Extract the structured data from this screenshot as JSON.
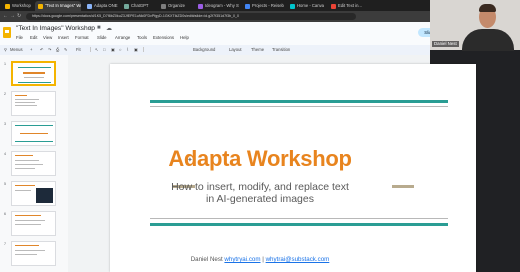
{
  "browser": {
    "tabs": [
      {
        "label": "Workshop",
        "active": false,
        "color": "#f4b400"
      },
      {
        "label": "\"Text In Images\" Works",
        "active": true,
        "color": "#f4b400"
      },
      {
        "label": "Adapta ONE",
        "active": false,
        "color": "#8ab4f8"
      },
      {
        "label": "ChatGPT",
        "active": false,
        "color": "#74aa9c"
      },
      {
        "label": "Organize",
        "active": false,
        "color": "#7e7e7e"
      },
      {
        "label": "Ideogram - Why Style",
        "active": false,
        "color": "#9b5de5"
      },
      {
        "label": "Projects - Reiseb",
        "active": false,
        "color": "#4285f4"
      },
      {
        "label": "Home - Canva",
        "active": false,
        "color": "#00c4cc"
      },
      {
        "label": "Edit Text in...",
        "active": false,
        "color": "#ea4335"
      }
    ],
    "url": "https://docs.google.com/presentation/d/1K5_D7f8bZ0kuZ3JfEPE1uNk0FDvPfgyD-1GKXTIkZD0s/edit#slide=id.g2f7f351d7f3b_0_0"
  },
  "docs": {
    "title": "\"Text In Images\" Workshop",
    "menu": [
      "File",
      "Edit",
      "View",
      "Insert",
      "Format",
      "Slide",
      "Arrange",
      "Tools",
      "Extensions",
      "Help"
    ],
    "slideshow_label": "Slides",
    "toolbar": {
      "menus_label": "Menus",
      "zoom_label": "Fit",
      "background_label": "Background",
      "layout_label": "Layout",
      "theme_label": "Theme",
      "transition_label": "Transition"
    }
  },
  "filmstrip": {
    "numbers": [
      "1",
      "2",
      "3",
      "4",
      "5",
      "6",
      "7"
    ]
  },
  "slide": {
    "title": "Adapta Workshop",
    "subtitle_line1": "How to insert, modify, and replace text",
    "subtitle_line2": "in AI-generated images",
    "footer_name": "Daniel Nest",
    "footer_link1": "whytryai.com",
    "footer_sep": "|",
    "footer_link2": "whytrai@substack.com"
  },
  "webcam": {
    "name": "Daniel Nest"
  },
  "colors": {
    "accent": "#e8841e",
    "teal": "#2a9d94",
    "tan": "#b8ab8e",
    "selected": "#f4b400"
  }
}
